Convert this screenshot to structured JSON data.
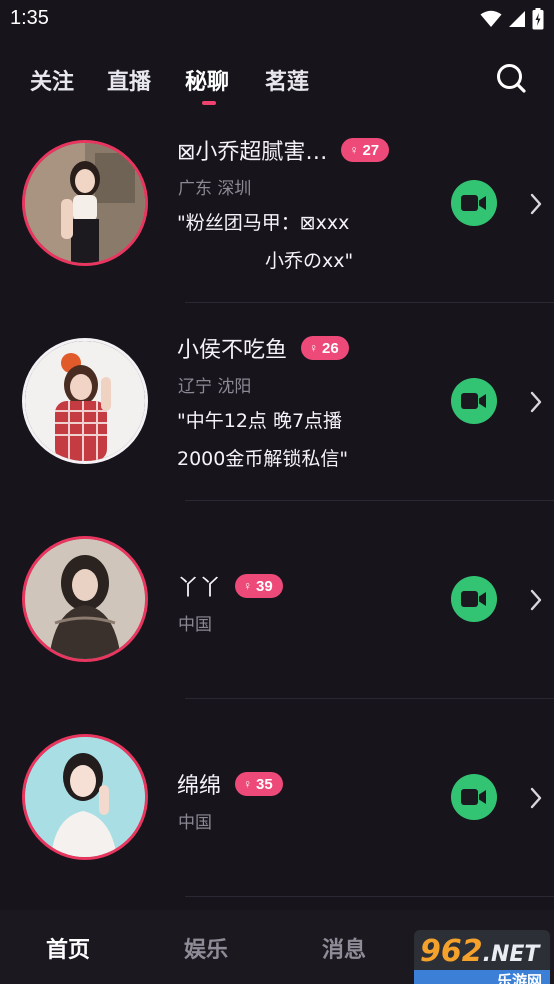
{
  "status_bar": {
    "time": "1:35",
    "icons": [
      "wifi-icon",
      "signal-icon",
      "battery-icon"
    ]
  },
  "top_tabs": {
    "items": [
      {
        "label": "关注"
      },
      {
        "label": "直播"
      },
      {
        "label": "秘聊"
      },
      {
        "label": "茗莲"
      }
    ],
    "active": "秘聊",
    "accent": "#f0426f"
  },
  "users": [
    {
      "name": "⊠小乔超腻害…",
      "badge_symbol": "♀",
      "badge_count": "27",
      "location": "广东 深圳",
      "signature_line1": "\"粉丝团马甲：⊠xxx",
      "signature_line2": "小乔のxx\""
    },
    {
      "name": "小侯不吃鱼",
      "badge_symbol": "♀",
      "badge_count": "26",
      "location": "辽宁 沈阳",
      "signature_line1": "\"中午12点 晚7点播",
      "signature_line2": "2000金币解锁私信\""
    },
    {
      "name": "丫丫",
      "badge_symbol": "♀",
      "badge_count": "39",
      "location": "中国"
    },
    {
      "name": "绵绵",
      "badge_symbol": "♀",
      "badge_count": "35",
      "location": "中国"
    }
  ],
  "bottom_nav": {
    "items": [
      {
        "label": "首页"
      },
      {
        "label": "娱乐"
      },
      {
        "label": "消息"
      }
    ],
    "active": "首页"
  },
  "watermark": {
    "big": "962",
    "suffix": ".NET",
    "small": "乐游网"
  },
  "colors": {
    "background": "#17141c",
    "badge": "#ee4a79",
    "video_button": "#33c473",
    "avatar_ring": "#e8365f"
  }
}
